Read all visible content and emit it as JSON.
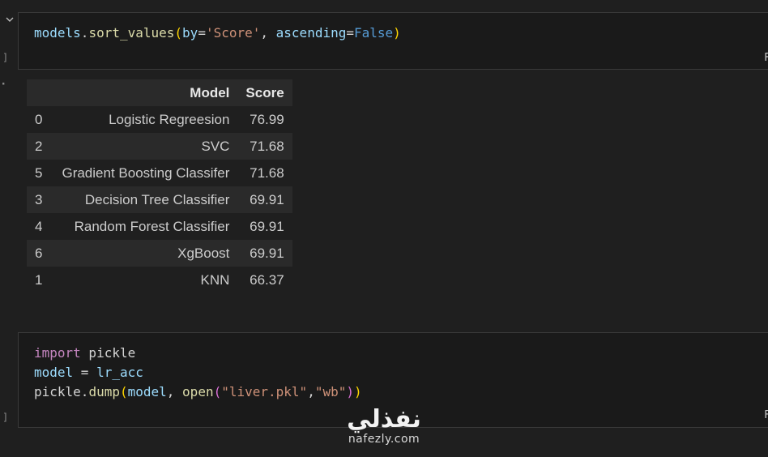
{
  "cell1": {
    "code_tokens": [
      "models",
      ".",
      "sort_values",
      "(",
      "by",
      "=",
      "'Score'",
      ", ",
      "ascending",
      "=",
      "False",
      ")"
    ],
    "bracket_left": "]",
    "truncated_right": "F"
  },
  "output": {
    "gutter_mark": "·",
    "table": {
      "columns": [
        "Model",
        "Score"
      ],
      "rows": [
        {
          "index": "0",
          "model": "Logistic Regreesion",
          "score": "76.99"
        },
        {
          "index": "2",
          "model": "SVC",
          "score": "71.68"
        },
        {
          "index": "5",
          "model": "Gradient Boosting Classifer",
          "score": "71.68"
        },
        {
          "index": "3",
          "model": "Decision Tree Classifier",
          "score": "69.91"
        },
        {
          "index": "4",
          "model": "Random Forest Classifier",
          "score": "69.91"
        },
        {
          "index": "6",
          "model": "XgBoost",
          "score": "69.91"
        },
        {
          "index": "1",
          "model": "KNN",
          "score": "66.37"
        }
      ]
    }
  },
  "cell2": {
    "line1": {
      "kw": "import",
      "name": " pickle"
    },
    "line2": {
      "lhs": "model",
      "op": " = ",
      "rhs": "lr_acc"
    },
    "line3": {
      "obj": "pickle",
      "dot": ".",
      "fn": "dump",
      "open1": "(",
      "arg1": "model",
      "comma": ", ",
      "fn2": "open",
      "open2": "(",
      "s1": "\"liver.pkl\"",
      "comma2": ",",
      "s2": "\"wb\"",
      "close2": ")",
      "close1": ")"
    },
    "bracket_left": "]",
    "truncated_right": "F"
  },
  "watermark": {
    "arabic": "نفذلي",
    "latin": "nafezly.com"
  },
  "colors": {
    "background": "#1f1f1f",
    "keyword": "#c586c0",
    "string": "#ce9178",
    "function": "#dcdcaa",
    "variable": "#9cdcfe",
    "constant": "#569cd6"
  }
}
